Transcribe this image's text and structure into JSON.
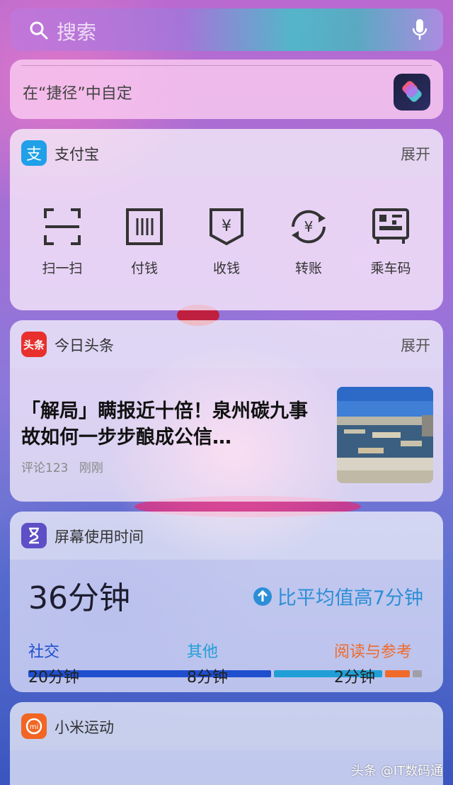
{
  "search": {
    "placeholder": "搜索"
  },
  "shortcut": {
    "text": "在“捷径”中自定"
  },
  "alipay": {
    "title": "支付宝",
    "expand": "展开",
    "actions": [
      {
        "label": "扫一扫",
        "icon": "scan-icon"
      },
      {
        "label": "付钱",
        "icon": "pay-icon"
      },
      {
        "label": "收钱",
        "icon": "receive-icon"
      },
      {
        "label": "转账",
        "icon": "transfer-icon"
      },
      {
        "label": "乘车码",
        "icon": "transit-code-icon"
      }
    ]
  },
  "toutiao": {
    "title": "今日头条",
    "expand": "展开",
    "logo_text": "头条",
    "headline": "「解局」瞒报近十倍！泉州碳九事故如何一步步酿成公信…",
    "comments": "评论123",
    "time": "刚刚"
  },
  "screentime": {
    "title": "屏幕使用时间",
    "total": "36分钟",
    "delta": "比平均值高7分钟",
    "categories": [
      {
        "name": "社交",
        "value": "20分钟",
        "color": "#1f4fcf"
      },
      {
        "name": "其他",
        "value": "8分钟",
        "color": "#1f9fd6"
      },
      {
        "name": "阅读与参考",
        "value": "2分钟",
        "color": "#f06a2a"
      }
    ],
    "bar_fractions": [
      0.62,
      0.28,
      0.07,
      0.03
    ],
    "bar_colors": [
      "#1f4fcf",
      "#1f9fd6",
      "#f06a2a",
      "#a0a0a8"
    ]
  },
  "mifit": {
    "title": "小米运动"
  },
  "watermark": "头条 @IT数码通"
}
